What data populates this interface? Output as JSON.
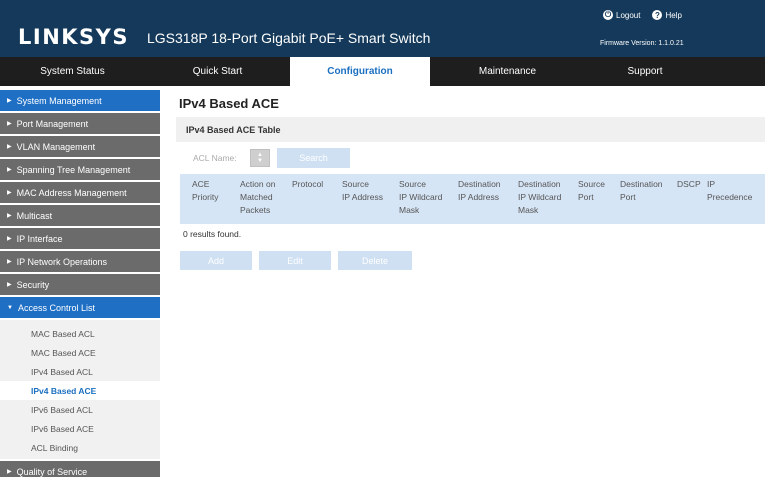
{
  "header": {
    "logo": "LINKSYS",
    "product": "LGS318P 18-Port Gigabit PoE+ Smart Switch",
    "logout_label": "Logout",
    "help_label": "Help",
    "firmware": "Firmware Version: 1.1.0.21"
  },
  "nav": {
    "tabs": [
      {
        "label": "System Status"
      },
      {
        "label": "Quick Start"
      },
      {
        "label": "Configuration"
      },
      {
        "label": "Maintenance"
      },
      {
        "label": "Support"
      }
    ]
  },
  "sidebar": {
    "items": [
      {
        "label": "System Management"
      },
      {
        "label": "Port Management"
      },
      {
        "label": "VLAN Management"
      },
      {
        "label": "Spanning Tree Management"
      },
      {
        "label": "MAC Address Management"
      },
      {
        "label": "Multicast"
      },
      {
        "label": "IP Interface"
      },
      {
        "label": "IP Network Operations"
      },
      {
        "label": "Security"
      },
      {
        "label": "Access Control List"
      },
      {
        "label": "Quality of Service"
      }
    ],
    "acl_sub": [
      {
        "label": "MAC Based ACL"
      },
      {
        "label": "MAC Based ACE"
      },
      {
        "label": "IPv4 Based ACL"
      },
      {
        "label": "IPv4 Based ACE"
      },
      {
        "label": "IPv6 Based ACL"
      },
      {
        "label": "IPv6 Based ACE"
      },
      {
        "label": "ACL Binding"
      }
    ]
  },
  "main": {
    "title": "IPv4 Based ACE",
    "section_title": "IPv4 Based ACE Table",
    "acl_name_label": "ACL Name:",
    "search_label": "Search",
    "columns": [
      "ACE\nPriority",
      "Action on\nMatched\nPackets",
      "Protocol",
      "Source\nIP Address",
      "Source\nIP Wildcard\nMask",
      "Destination\nIP Address",
      "Destination\nIP Wildcard\nMask",
      "Source\nPort",
      "Destination\nPort",
      "DSCP",
      "IP\nPrecedence"
    ],
    "results": "0 results found.",
    "add_label": "Add",
    "edit_label": "Edit",
    "delete_label": "Delete"
  },
  "colors": {
    "header_bg": "#14395a",
    "nav_bg": "#1e1e1e",
    "active_blue": "#1f6fc5",
    "sidebar_gray": "#6b6b6b",
    "table_header_bg": "#d6e5f6",
    "disabled_button": "#cfe0f3"
  }
}
